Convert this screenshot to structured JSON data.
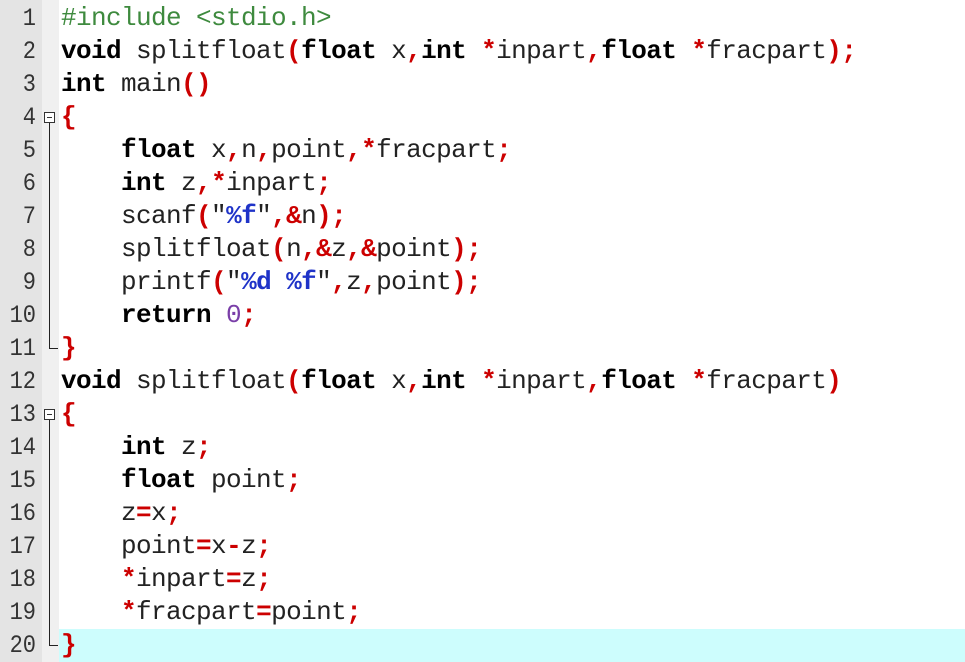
{
  "editor": {
    "current_line": 20,
    "colors": {
      "keyword": "#000000",
      "operator": "#cc0000",
      "preprocessor": "#3e8a3e",
      "format_specifier": "#1f33c8",
      "number": "#7a3fa8",
      "gutter_bg": "#e4e4e4",
      "current_line_bg": "#cdfdfd"
    },
    "lines": [
      {
        "n": "1",
        "fold": "",
        "tokens": [
          [
            "pp",
            "#include <stdio.h>"
          ]
        ]
      },
      {
        "n": "2",
        "fold": "",
        "tokens": [
          [
            "kw",
            "void"
          ],
          [
            "id",
            " splitfloat"
          ],
          [
            "op",
            "("
          ],
          [
            "kw",
            "float"
          ],
          [
            "id",
            " x"
          ],
          [
            "op",
            ","
          ],
          [
            "kw",
            "int"
          ],
          [
            "id",
            " "
          ],
          [
            "op",
            "*"
          ],
          [
            "id",
            "inpart"
          ],
          [
            "op",
            ","
          ],
          [
            "kw",
            "float"
          ],
          [
            "id",
            " "
          ],
          [
            "op",
            "*"
          ],
          [
            "id",
            "fracpart"
          ],
          [
            "op",
            ")"
          ],
          [
            "op",
            ";"
          ]
        ]
      },
      {
        "n": "3",
        "fold": "",
        "tokens": [
          [
            "kw",
            "int"
          ],
          [
            "id",
            " main"
          ],
          [
            "op",
            "()"
          ]
        ]
      },
      {
        "n": "4",
        "fold": "open",
        "tokens": [
          [
            "op",
            "{"
          ]
        ]
      },
      {
        "n": "5",
        "fold": "body",
        "tokens": [
          [
            "id",
            "    "
          ],
          [
            "kw",
            "float"
          ],
          [
            "id",
            " x"
          ],
          [
            "op",
            ","
          ],
          [
            "id",
            "n"
          ],
          [
            "op",
            ","
          ],
          [
            "id",
            "point"
          ],
          [
            "op",
            ","
          ],
          [
            "op",
            "*"
          ],
          [
            "id",
            "fracpart"
          ],
          [
            "op",
            ";"
          ]
        ]
      },
      {
        "n": "6",
        "fold": "body",
        "tokens": [
          [
            "id",
            "    "
          ],
          [
            "kw",
            "int"
          ],
          [
            "id",
            " z"
          ],
          [
            "op",
            ","
          ],
          [
            "op",
            "*"
          ],
          [
            "id",
            "inpart"
          ],
          [
            "op",
            ";"
          ]
        ]
      },
      {
        "n": "7",
        "fold": "body",
        "tokens": [
          [
            "id",
            "    scanf"
          ],
          [
            "op",
            "("
          ],
          [
            "str",
            "\""
          ],
          [
            "fmt",
            "%f"
          ],
          [
            "str",
            "\""
          ],
          [
            "op",
            ","
          ],
          [
            "op",
            "&"
          ],
          [
            "id",
            "n"
          ],
          [
            "op",
            ")"
          ],
          [
            "op",
            ";"
          ]
        ]
      },
      {
        "n": "8",
        "fold": "body",
        "tokens": [
          [
            "id",
            "    splitfloat"
          ],
          [
            "op",
            "("
          ],
          [
            "id",
            "n"
          ],
          [
            "op",
            ","
          ],
          [
            "op",
            "&"
          ],
          [
            "id",
            "z"
          ],
          [
            "op",
            ","
          ],
          [
            "op",
            "&"
          ],
          [
            "id",
            "point"
          ],
          [
            "op",
            ")"
          ],
          [
            "op",
            ";"
          ]
        ]
      },
      {
        "n": "9",
        "fold": "body",
        "tokens": [
          [
            "id",
            "    printf"
          ],
          [
            "op",
            "("
          ],
          [
            "str",
            "\""
          ],
          [
            "fmt",
            "%d %f"
          ],
          [
            "str",
            "\""
          ],
          [
            "op",
            ","
          ],
          [
            "id",
            "z"
          ],
          [
            "op",
            ","
          ],
          [
            "id",
            "point"
          ],
          [
            "op",
            ")"
          ],
          [
            "op",
            ";"
          ]
        ]
      },
      {
        "n": "10",
        "fold": "body",
        "tokens": [
          [
            "id",
            "    "
          ],
          [
            "kw",
            "return"
          ],
          [
            "id",
            " "
          ],
          [
            "num",
            "0"
          ],
          [
            "op",
            ";"
          ]
        ]
      },
      {
        "n": "11",
        "fold": "end",
        "tokens": [
          [
            "op",
            "}"
          ]
        ]
      },
      {
        "n": "12",
        "fold": "",
        "tokens": [
          [
            "kw",
            "void"
          ],
          [
            "id",
            " splitfloat"
          ],
          [
            "op",
            "("
          ],
          [
            "kw",
            "float"
          ],
          [
            "id",
            " x"
          ],
          [
            "op",
            ","
          ],
          [
            "kw",
            "int"
          ],
          [
            "id",
            " "
          ],
          [
            "op",
            "*"
          ],
          [
            "id",
            "inpart"
          ],
          [
            "op",
            ","
          ],
          [
            "kw",
            "float"
          ],
          [
            "id",
            " "
          ],
          [
            "op",
            "*"
          ],
          [
            "id",
            "fracpart"
          ],
          [
            "op",
            ")"
          ]
        ]
      },
      {
        "n": "13",
        "fold": "open",
        "tokens": [
          [
            "op",
            "{"
          ]
        ]
      },
      {
        "n": "14",
        "fold": "body",
        "tokens": [
          [
            "id",
            "    "
          ],
          [
            "kw",
            "int"
          ],
          [
            "id",
            " z"
          ],
          [
            "op",
            ";"
          ]
        ]
      },
      {
        "n": "15",
        "fold": "body",
        "tokens": [
          [
            "id",
            "    "
          ],
          [
            "kw",
            "float"
          ],
          [
            "id",
            " point"
          ],
          [
            "op",
            ";"
          ]
        ]
      },
      {
        "n": "16",
        "fold": "body",
        "tokens": [
          [
            "id",
            "    z"
          ],
          [
            "op",
            "="
          ],
          [
            "id",
            "x"
          ],
          [
            "op",
            ";"
          ]
        ]
      },
      {
        "n": "17",
        "fold": "body",
        "tokens": [
          [
            "id",
            "    point"
          ],
          [
            "op",
            "="
          ],
          [
            "id",
            "x"
          ],
          [
            "op",
            "-"
          ],
          [
            "id",
            "z"
          ],
          [
            "op",
            ";"
          ]
        ]
      },
      {
        "n": "18",
        "fold": "body",
        "tokens": [
          [
            "id",
            "    "
          ],
          [
            "op",
            "*"
          ],
          [
            "id",
            "inpart"
          ],
          [
            "op",
            "="
          ],
          [
            "id",
            "z"
          ],
          [
            "op",
            ";"
          ]
        ]
      },
      {
        "n": "19",
        "fold": "body",
        "tokens": [
          [
            "id",
            "    "
          ],
          [
            "op",
            "*"
          ],
          [
            "id",
            "fracpart"
          ],
          [
            "op",
            "="
          ],
          [
            "id",
            "point"
          ],
          [
            "op",
            ";"
          ]
        ]
      },
      {
        "n": "20",
        "fold": "end",
        "tokens": [
          [
            "op",
            "}"
          ]
        ]
      }
    ]
  }
}
